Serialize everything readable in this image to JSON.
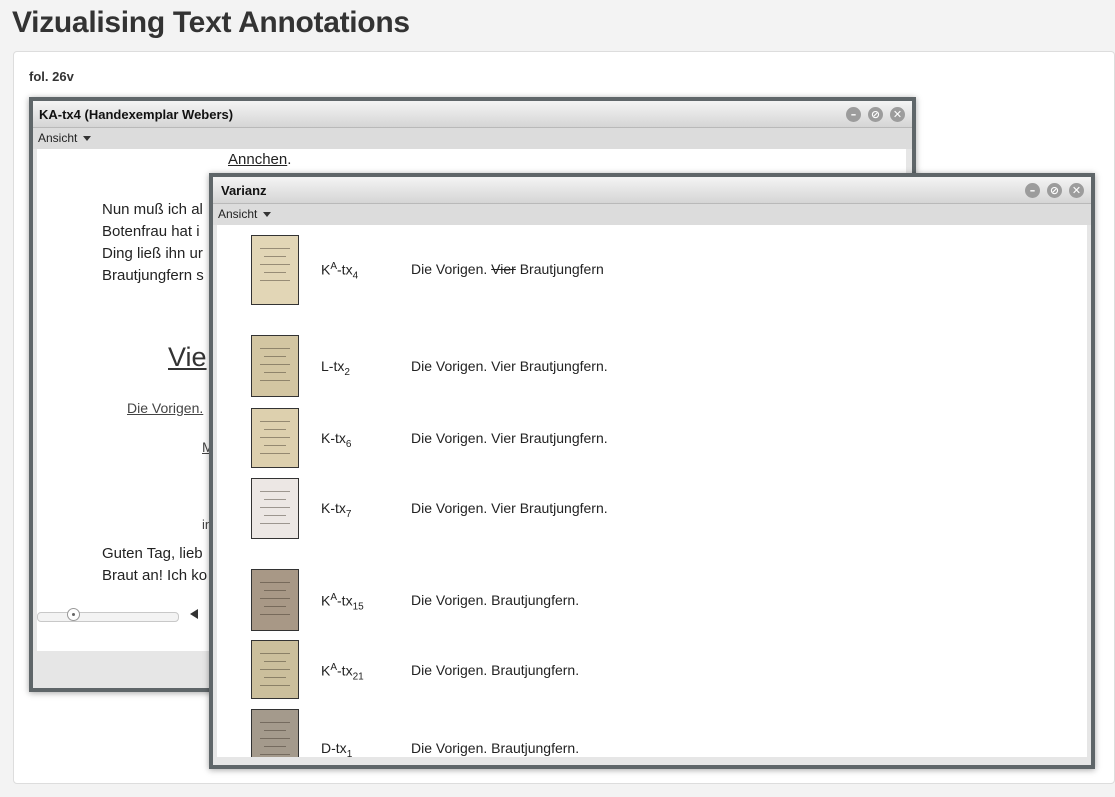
{
  "page": {
    "title": "Vizualising Text Annotations",
    "folio": "fol. 26v"
  },
  "window_main": {
    "title": "KA-tx4 (Handexemplar Webers)",
    "menu_label": "Ansicht",
    "text": {
      "annchen": "Annchen",
      "period": ".",
      "line1": "Nun muß ich al",
      "line2": "Botenfrau hat i",
      "line3": "Ding ließ ihn ur",
      "line4": "Brautjungfern s",
      "heading": "Vie",
      "stage": "Die Vorigen.",
      "m_fragment": "M",
      "i_fragment": "in",
      "line5": "Guten Tag, lieb",
      "line6": "Braut an! Ich ko"
    },
    "controls": {
      "minimize": "–",
      "restore": "⊘",
      "close": "✕"
    },
    "slider_position": 0.25
  },
  "window_variance": {
    "title": "Varianz",
    "menu_label": "Ansicht",
    "controls": {
      "minimize": "–",
      "restore": "⊘",
      "close": "✕"
    },
    "rows": [
      {
        "sig_base": "K",
        "sig_sup": "A",
        "sig_mid": "-tx",
        "sig_sub": "4",
        "reading_a": "Die Vorigen. ",
        "reading_strike": "Vier",
        "reading_b": " Brautjungfern",
        "thumb_color": "#e2d6b6"
      },
      {
        "sig_base": "L",
        "sig_sup": "",
        "sig_mid": "-tx",
        "sig_sub": "2",
        "reading_a": "Die Vorigen. Vier Brautjungfern.",
        "reading_strike": "",
        "reading_b": "",
        "thumb_color": "#d3c6a2"
      },
      {
        "sig_base": "K",
        "sig_sup": "",
        "sig_mid": "-tx",
        "sig_sub": "6",
        "reading_a": "Die Vorigen. Vier Brautjungfern.",
        "reading_strike": "",
        "reading_b": "",
        "thumb_color": "#ddd0ae"
      },
      {
        "sig_base": "K",
        "sig_sup": "",
        "sig_mid": "-tx",
        "sig_sub": "7",
        "reading_a": "Die Vorigen. Vier Brautjungfern.",
        "reading_strike": "",
        "reading_b": "",
        "thumb_color": "#ece7e4"
      },
      {
        "sig_base": "K",
        "sig_sup": "A",
        "sig_mid": "-tx",
        "sig_sub": "15",
        "reading_a": "Die Vorigen. Brautjungfern.",
        "reading_strike": "",
        "reading_b": "",
        "thumb_color": "#a89886"
      },
      {
        "sig_base": "K",
        "sig_sup": "A",
        "sig_mid": "-tx",
        "sig_sub": "21",
        "reading_a": "Die Vorigen. Brautjungfern.",
        "reading_strike": "",
        "reading_b": "",
        "thumb_color": "#cbbf9c"
      },
      {
        "sig_base": "D",
        "sig_sup": "",
        "sig_mid": "-tx",
        "sig_sub": "1",
        "reading_a": "Die Vorigen. Brautjungfern.",
        "reading_strike": "",
        "reading_b": "",
        "thumb_color": "#a49a8c"
      }
    ]
  }
}
